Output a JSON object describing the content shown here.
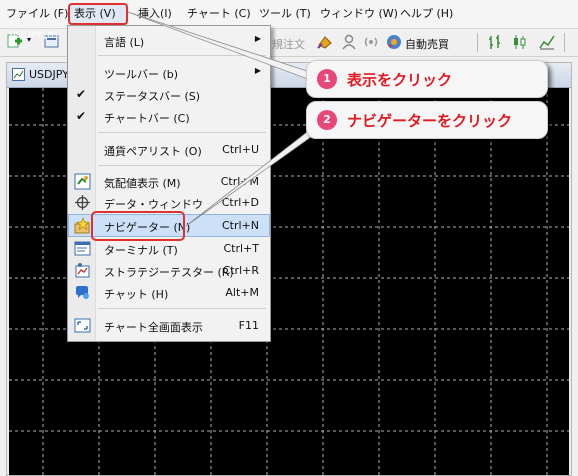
{
  "menubar": {
    "items": [
      "ファイル (F)",
      "表示 (V)",
      "挿入(I)",
      "チャート (C)",
      "ツール (T)",
      "ウィンドウ (W)",
      "ヘルプ (H)"
    ]
  },
  "toolbar": {
    "order_text": "規注文",
    "auto_trade": "自動売買"
  },
  "chart": {
    "tab_title": "USDJPY",
    "symbol_label": "USDJPY,M1"
  },
  "view_menu": {
    "items": [
      {
        "label": "言語 (L)",
        "shortcut": "",
        "submenu": true
      },
      {
        "label": "ツールバー (b)",
        "shortcut": "",
        "submenu": true
      },
      {
        "label": "ステータスバー (S)",
        "shortcut": "",
        "checked": true
      },
      {
        "label": "チャートバー (C)",
        "shortcut": "",
        "checked": true
      },
      {
        "label": "通貨ペアリスト (O)",
        "shortcut": "Ctrl+U"
      },
      {
        "label": "気配値表示 (M)",
        "shortcut": "Ctrl+M",
        "icon": "market-watch-icon"
      },
      {
        "label": "データ・ウィンドウ",
        "shortcut": "Ctrl+D",
        "icon": "crosshair-icon"
      },
      {
        "label": "ナビゲーター (N)",
        "shortcut": "Ctrl+N",
        "icon": "navigator-star-icon",
        "highlighted": true
      },
      {
        "label": "ターミナル (T)",
        "shortcut": "Ctrl+T",
        "icon": "terminal-icon"
      },
      {
        "label": "ストラテジーテスター (R)",
        "shortcut": "Ctrl+R",
        "icon": "strategy-tester-icon"
      },
      {
        "label": "チャット (H)",
        "shortcut": "Alt+M",
        "icon": "chat-icon"
      },
      {
        "label": "チャート全画面表示",
        "shortcut": "F11",
        "icon": "fullscreen-icon"
      }
    ]
  },
  "callouts": [
    {
      "number": "1",
      "text": "表示をクリック"
    },
    {
      "number": "2",
      "text": "ナビゲーターをクリック"
    }
  ],
  "colors": {
    "highlight_red": "#e0302f",
    "callout_text": "#e11a22",
    "callout_badge": "#e8477a",
    "menu_highlight": "#cce0f7",
    "chart_background": "#000000",
    "chart_grid": "#b0b0b0"
  }
}
